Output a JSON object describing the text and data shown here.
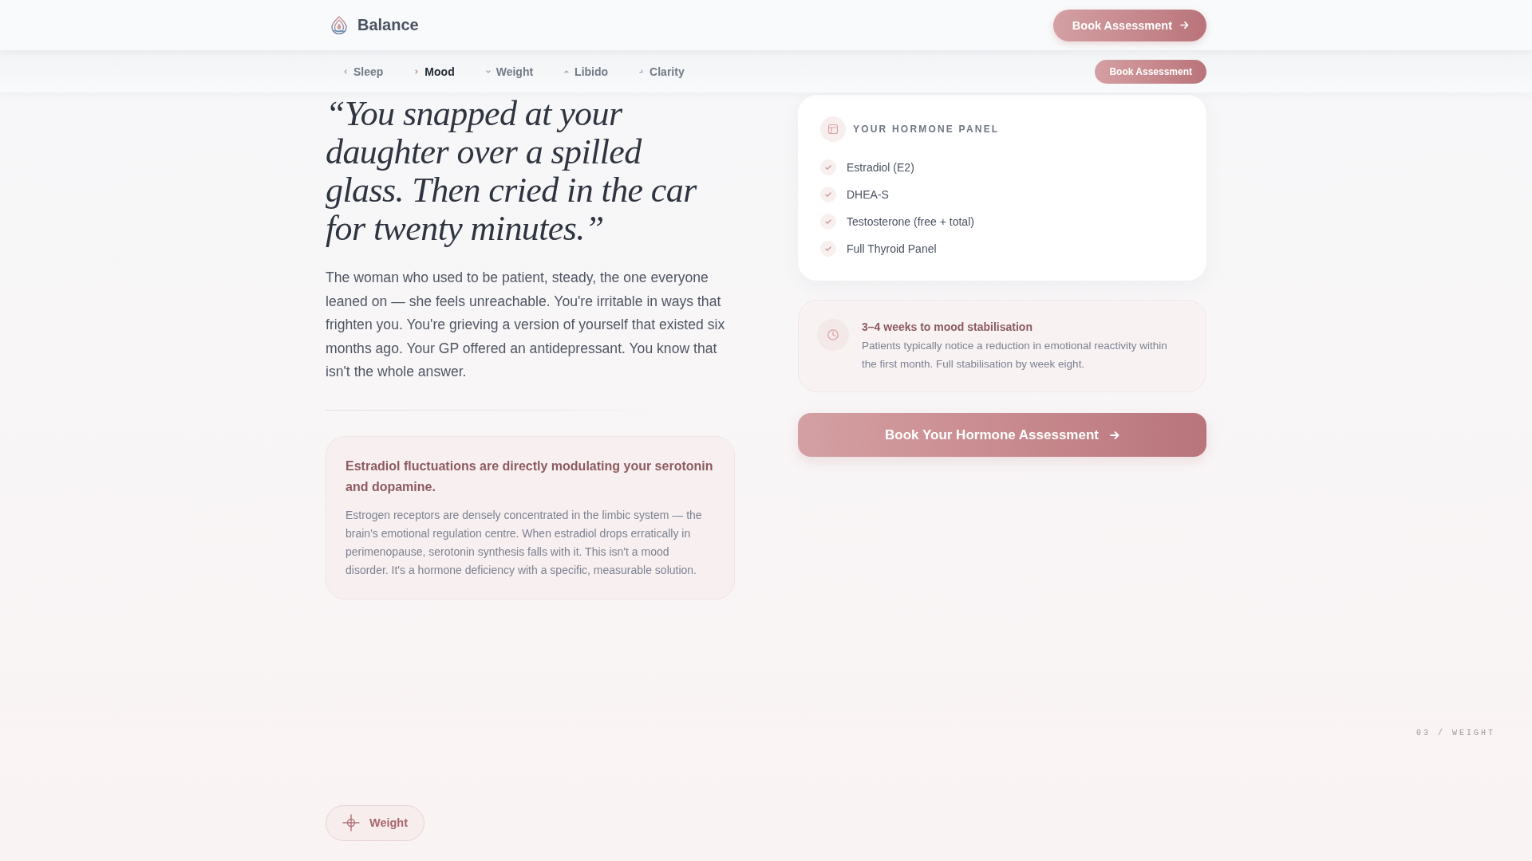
{
  "header": {
    "brand": "Balance",
    "cta": "Book Assessment"
  },
  "nav": {
    "items": [
      {
        "label": "Sleep",
        "selected": false
      },
      {
        "label": "Mood",
        "selected": true
      },
      {
        "label": "Weight",
        "selected": false
      },
      {
        "label": "Libido",
        "selected": false
      },
      {
        "label": "Clarity",
        "selected": false
      }
    ],
    "cta": "Book Assessment"
  },
  "quote": "“You snapped at your daughter over a spilled glass. Then cried in the car for twenty minutes.”",
  "story": "The woman who used to be patient, steady, the one everyone leaned on — she feels unreachable. You're irritable in ways that frighten you. You're grieving a version of yourself that existed six months ago. Your GP offered an antidepressant. You know that isn't the whole answer.",
  "insight": {
    "title": "Estradiol fluctuations are directly modulating your serotonin and dopamine.",
    "body": "Estrogen receptors are densely concentrated in the limbic system — the brain's emotional regulation centre. When estradiol drops erratically in perimenopause, serotonin synthesis falls with it. This isn't a mood disorder. It's a hormone deficiency with a specific, measurable solution."
  },
  "panel": {
    "title": "YOUR HORMONE PANEL",
    "items": [
      {
        "label": "Estradiol (E2)",
        "checked": true
      },
      {
        "label": "DHEA-S",
        "checked": true
      },
      {
        "label": "Testosterone (free + total)",
        "checked": true
      },
      {
        "label": "Full Thyroid Panel",
        "checked": true
      }
    ]
  },
  "timeline": {
    "title": "3–4 weeks to mood stabilisation",
    "body": "Patients typically notice a reduction in emotional reactivity within the first month. Full stabilisation by week eight."
  },
  "cta": "Book Your Hormone Assessment",
  "section_indicator": "03 / WEIGHT",
  "next_section": {
    "label": "Weight"
  }
}
